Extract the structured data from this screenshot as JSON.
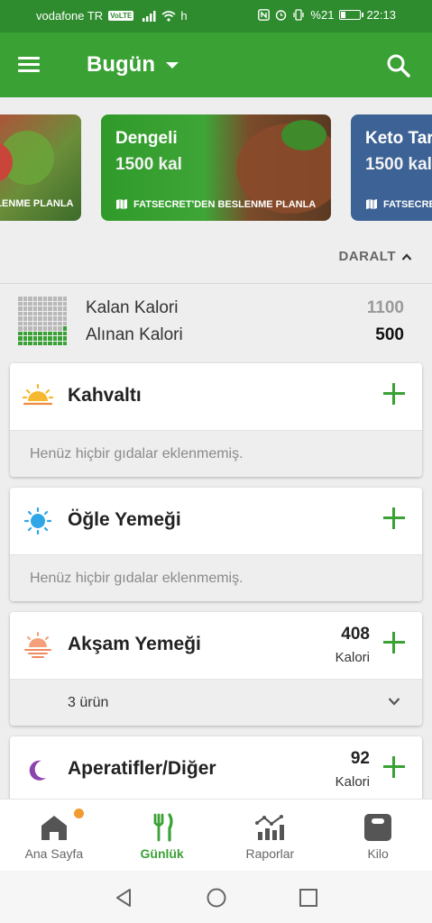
{
  "status_bar": {
    "carrier": "vodafone TR",
    "volte": "VoLTE",
    "network": "h",
    "battery_text": "%21",
    "time": "22:13",
    "battery_level": 0.21
  },
  "app_bar": {
    "title": "Bugün",
    "menu_icon": "hamburger-menu-icon",
    "dropdown_icon": "caret-down-icon",
    "search_icon": "search-icon"
  },
  "plans": [
    {
      "name": "",
      "kcal": "",
      "footer": "ELENME PLANLA"
    },
    {
      "name": "Dengeli",
      "kcal": "1500 kal",
      "footer": "FATSECRET'DEN BESLENME PLANLA"
    },
    {
      "name": "Keto Tar",
      "kcal": "1500 kal",
      "footer": "FATSECRET"
    }
  ],
  "collapse_label": "DARALT",
  "summary": {
    "remaining_label": "Kalan Kalori",
    "remaining_value": "1100",
    "consumed_label": "Alınan Kalori",
    "consumed_value": "500",
    "consumed_fraction": 0.3125
  },
  "meals": [
    {
      "title": "Kahvaltı",
      "icon": "sunrise-icon",
      "empty_text": "Henüz hiçbir gıdalar eklenmemiş."
    },
    {
      "title": "Öğle Yemeği",
      "icon": "sun-icon",
      "empty_text": "Henüz hiçbir gıdalar eklenmemiş."
    },
    {
      "title": "Akşam Yemeği",
      "icon": "sunset-icon",
      "kcal": "408",
      "kcal_unit": "Kalori",
      "items_text": "3 ürün"
    },
    {
      "title": "Aperatifler/Diğer",
      "icon": "moon-icon",
      "kcal": "92",
      "kcal_unit": "Kalori"
    }
  ],
  "bottom_nav": [
    {
      "label": "Ana Sayfa",
      "icon": "home-icon",
      "active": false,
      "badge": true
    },
    {
      "label": "Günlük",
      "icon": "fork-knife-icon",
      "active": true
    },
    {
      "label": "Raporlar",
      "icon": "reports-chart-icon",
      "active": false
    },
    {
      "label": "Kilo",
      "icon": "scale-icon",
      "active": false
    }
  ],
  "colors": {
    "primary": "#3aa135",
    "status_bar": "#2e8b2e",
    "badge": "#f29b32",
    "keto_card": "#3d6295"
  }
}
